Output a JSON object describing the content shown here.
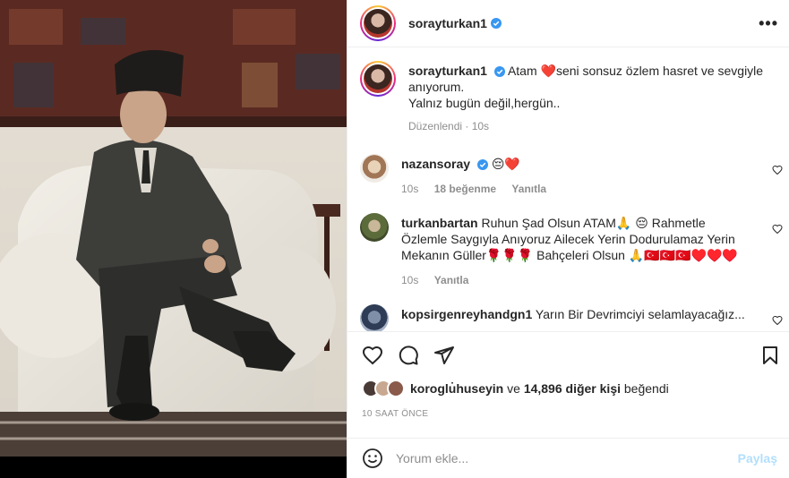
{
  "post": {
    "username": "sorayturkan1",
    "more_label": "•••"
  },
  "caption": {
    "username": "sorayturkan1",
    "text_before": "Atam",
    "emoji_heart": "❤️",
    "text_after": "seni sonsuz özlem hasret ve sevgiyle",
    "line2": "anıyorum.",
    "line3": "Yalnız bugün değil,hergün..",
    "meta": "Düzenlendi · 10s"
  },
  "comments": [
    {
      "username": "nazansoray",
      "text": "😔❤️",
      "time": "10s",
      "likes": "18 beğenme",
      "reply": "Yanıtla"
    },
    {
      "username": "turkanbartan",
      "line1": "Ruhun Şad Olsun ATAM🙏 😔 Rahmetle",
      "line2": "Özlemle Saygıyla Anıyoruz Ailecek Yerin Dodurulamaz Yerin",
      "line3": "Mekanın Güller🌹🌹🌹 Bahçeleri Olsun 🙏🇹🇷🇹🇷🇹🇷♥️♥️♥️",
      "time": "10s",
      "reply": "Yanıtla"
    },
    {
      "username": "kopsirgenreyhandgn1",
      "text": "Yarın Bir Devrimciyi selamlayacağız..."
    }
  ],
  "likes": {
    "first_liker": "koroglu̇huseyin",
    "connector": "ve",
    "count": "14,896 diğer kişi",
    "suffix": "beğendi"
  },
  "timestamp": "10 SAAT ÖNCE",
  "comment_input": {
    "placeholder": "Yorum ekle...",
    "share_label": "Paylaş"
  },
  "colors": {
    "verified": "#3897f0",
    "heart": "#ed4956",
    "link": "#b2dffc"
  }
}
